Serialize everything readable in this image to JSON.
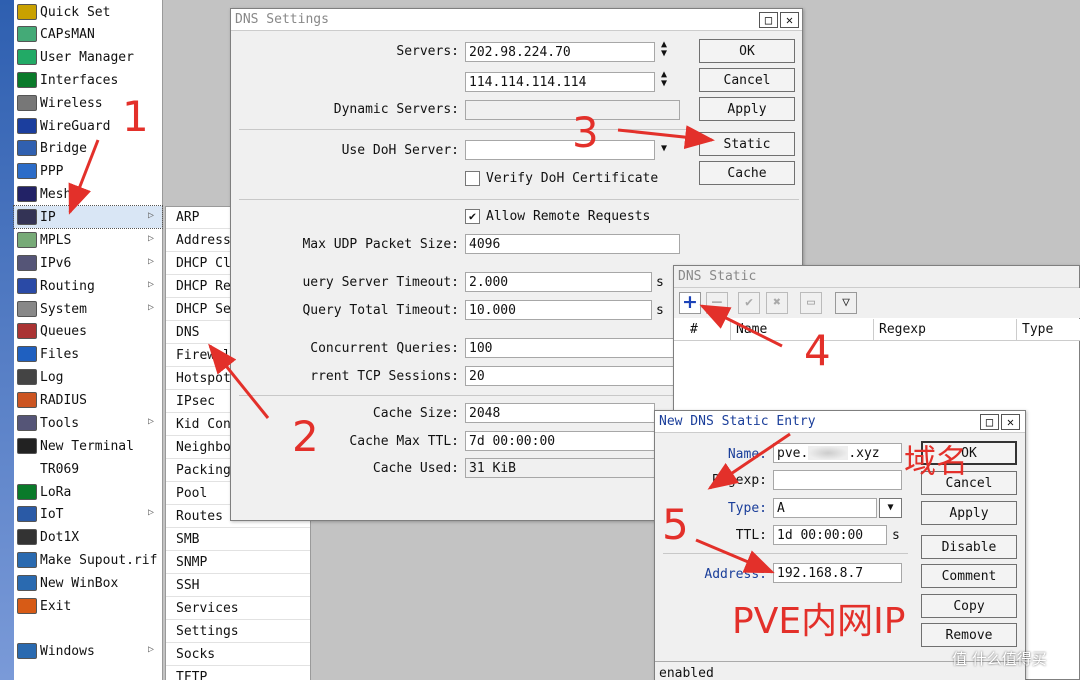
{
  "sidebar": {
    "items": [
      {
        "label": "Quick Set",
        "icon": "wand-icon",
        "arrow": false
      },
      {
        "label": "CAPsMAN",
        "icon": "capsman-icon",
        "arrow": false
      },
      {
        "label": "User Manager",
        "icon": "users-icon",
        "arrow": false
      },
      {
        "label": "Interfaces",
        "icon": "interfaces-icon",
        "arrow": false
      },
      {
        "label": "Wireless",
        "icon": "antenna-icon",
        "arrow": false
      },
      {
        "label": "WireGuard",
        "icon": "wireguard-icon",
        "arrow": false
      },
      {
        "label": "Bridge",
        "icon": "bridge-icon",
        "arrow": false
      },
      {
        "label": "PPP",
        "icon": "ppp-icon",
        "arrow": false
      },
      {
        "label": "Mesh",
        "icon": "mesh-icon",
        "arrow": false
      },
      {
        "label": "IP",
        "icon": "ip-icon",
        "arrow": true
      },
      {
        "label": "MPLS",
        "icon": "mpls-icon",
        "arrow": true
      },
      {
        "label": "IPv6",
        "icon": "ipv6-icon",
        "arrow": true
      },
      {
        "label": "Routing",
        "icon": "routing-icon",
        "arrow": true
      },
      {
        "label": "System",
        "icon": "gear-icon",
        "arrow": true
      },
      {
        "label": "Queues",
        "icon": "queues-icon",
        "arrow": false
      },
      {
        "label": "Files",
        "icon": "folder-icon",
        "arrow": false
      },
      {
        "label": "Log",
        "icon": "log-icon",
        "arrow": false
      },
      {
        "label": "RADIUS",
        "icon": "radius-icon",
        "arrow": false
      },
      {
        "label": "Tools",
        "icon": "tools-icon",
        "arrow": true
      },
      {
        "label": "New Terminal",
        "icon": "terminal-icon",
        "arrow": false
      },
      {
        "label": "TR069",
        "icon": "",
        "arrow": false
      },
      {
        "label": "LoRa",
        "icon": "lora-icon",
        "arrow": false
      },
      {
        "label": "IoT",
        "icon": "iot-icon",
        "arrow": true
      },
      {
        "label": "Dot1X",
        "icon": "dot1x-icon",
        "arrow": false
      },
      {
        "label": "Make Supout.rif",
        "icon": "supout-icon",
        "arrow": false
      },
      {
        "label": "New WinBox",
        "icon": "winbox-icon",
        "arrow": false
      },
      {
        "label": "Exit",
        "icon": "exit-icon",
        "arrow": false
      },
      {
        "label": "Windows",
        "icon": "windows-icon",
        "arrow": true
      }
    ]
  },
  "ip_menu": {
    "items": [
      "ARP",
      "Addresses",
      "DHCP Client",
      "DHCP Relay",
      "DHCP Server",
      "DNS",
      "Firewall",
      "Hotspot",
      "IPsec",
      "Kid Control",
      "Neighbors",
      "Packing",
      "Pool",
      "Routes",
      "SMB",
      "SNMP",
      "SSH",
      "Services",
      "Settings",
      "Socks",
      "TFTP"
    ]
  },
  "dns_settings": {
    "title": "DNS Settings",
    "servers_label": "Servers:",
    "server1": "202.98.224.70",
    "server2": "114.114.114.114",
    "dynamic_servers_label": "Dynamic Servers:",
    "doh_label": "Use DoH Server:",
    "verify_doh_label": "Verify DoH Certificate",
    "allow_remote_label": "Allow Remote Requests",
    "allow_remote_check": "✔",
    "max_udp_label": "Max UDP Packet Size:",
    "max_udp": "4096",
    "query_server_timeout_label": "uery Server Timeout:",
    "query_server_timeout": "2.000",
    "query_total_timeout_label": "Query Total Timeout:",
    "query_total_timeout": "10.000",
    "seconds_unit": "s",
    "concurrent_queries_label": "Concurrent Queries:",
    "concurrent_queries": "100",
    "tcp_sessions_label": "rrent TCP Sessions:",
    "tcp_sessions": "20",
    "cache_size_label": "Cache Size:",
    "cache_size": "2048",
    "cache_ttl_label": "Cache Max TTL:",
    "cache_ttl": "7d 00:00:00",
    "cache_used_label": "Cache Used:",
    "cache_used": "31 KiB",
    "buttons": {
      "ok": "OK",
      "cancel": "Cancel",
      "apply": "Apply",
      "static": "Static",
      "cache": "Cache"
    }
  },
  "dns_static": {
    "title": "DNS Static",
    "columns": [
      "#",
      "Name",
      "Regexp",
      "Type"
    ]
  },
  "new_entry": {
    "title": "New DNS Static Entry",
    "name_label": "Name:",
    "name_value": "pve.",
    "name_value_tail": ".xyz",
    "regexp_label": "Regexp:",
    "type_label": "Type:",
    "type_value": "A",
    "ttl_label": "TTL:",
    "ttl_value": "1d 00:00:00",
    "ttl_unit": "s",
    "address_label": "Address:",
    "address_value": "192.168.8.7",
    "status": "enabled",
    "buttons": {
      "ok": "OK",
      "cancel": "Cancel",
      "apply": "Apply",
      "disable": "Disable",
      "comment": "Comment",
      "copy": "Copy",
      "remove": "Remove"
    }
  },
  "annotations": {
    "step1": "1",
    "step2": "2",
    "step3": "3",
    "step4": "4",
    "step5": "5",
    "domain_note": "域名",
    "pve_note": "PVE内网IP"
  },
  "watermark": "值 什么值得买",
  "colors": {
    "annotation_red": "#e3302a",
    "sidebar_blue": "#2e5fb0",
    "title_blue": "#1a3e9a"
  }
}
